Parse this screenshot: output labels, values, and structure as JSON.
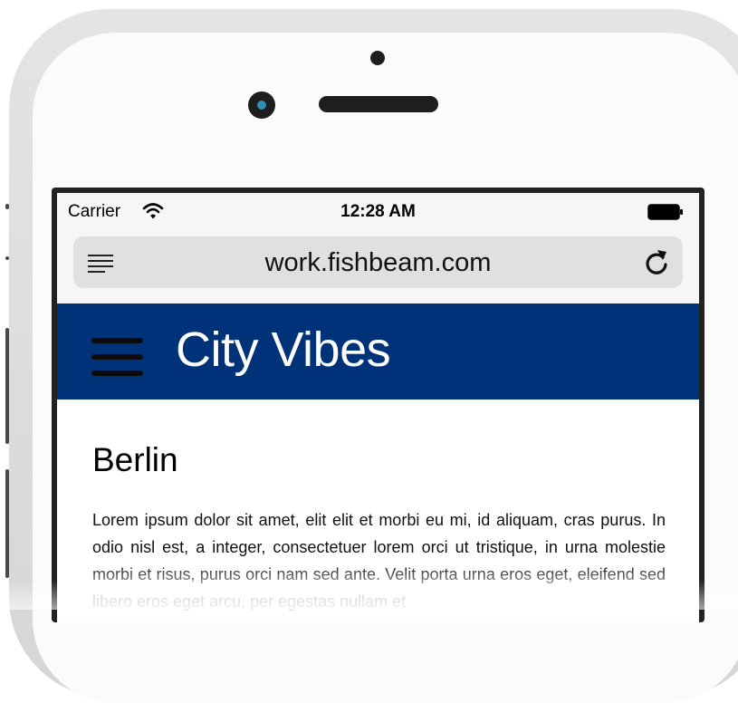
{
  "status_bar": {
    "carrier": "Carrier",
    "time": "12:28 AM",
    "wifi_icon": "wifi-icon",
    "battery_icon": "battery-icon"
  },
  "browser": {
    "url": "work.fishbeam.com",
    "reader_icon": "reader-list-icon",
    "reload_icon": "reload-icon"
  },
  "app_header": {
    "title": "City Vibes",
    "menu_icon": "hamburger-menu-icon",
    "background": "#003279"
  },
  "content": {
    "heading": "Berlin",
    "body": "Lorem ipsum dolor sit amet, elit elit et morbi eu mi, id aliquam, cras purus. In odio nisl est, a integer, consectetuer lorem orci ut tristique, in urna molestie morbi et risus, purus orci nam sed ante. Velit porta urna eros eget, eleifend sed libero eros eget arcu, per egestas nullam et"
  }
}
